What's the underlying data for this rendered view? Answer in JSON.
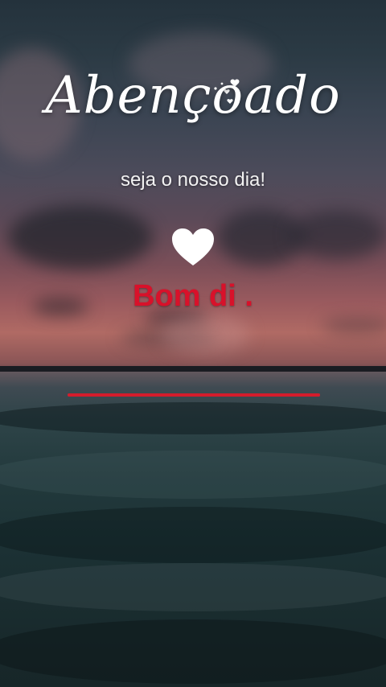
{
  "story": {
    "title": "Abençoado",
    "subtitle": "seja o nosso dia!",
    "greeting": "Bom di .",
    "progress": 1.0
  },
  "icons": {
    "heart": "heart-icon",
    "sparkles": "sparkle-hearts-icon"
  },
  "colors": {
    "greeting": "#d8112a",
    "progress": "#d41c2c",
    "text": "#ffffff"
  }
}
